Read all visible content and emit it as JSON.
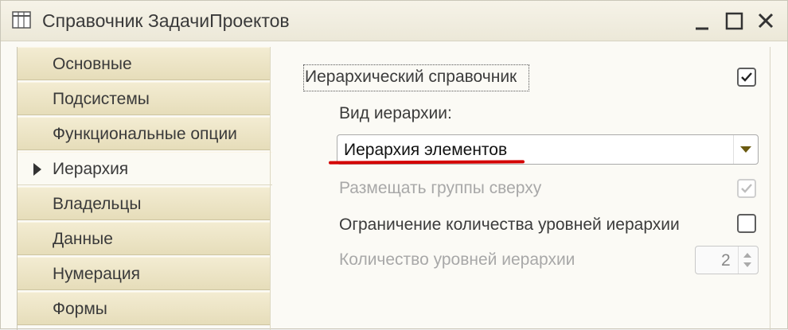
{
  "window": {
    "title": "Справочник ЗадачиПроектов",
    "icon": "table-icon",
    "controls": [
      "minimize-icon",
      "maximize-icon",
      "close-icon"
    ]
  },
  "sidebar": {
    "items": [
      {
        "label": "Основные",
        "active": false
      },
      {
        "label": "Подсистемы",
        "active": false
      },
      {
        "label": "Функциональные опции",
        "active": false
      },
      {
        "label": "Иерархия",
        "active": true
      },
      {
        "label": "Владельцы",
        "active": false
      },
      {
        "label": "Данные",
        "active": false
      },
      {
        "label": "Нумерация",
        "active": false
      },
      {
        "label": "Формы",
        "active": false
      }
    ]
  },
  "hierarchy": {
    "hierarchical_label": "Иерархический справочник",
    "hierarchical_checked": true,
    "kind_label": "Вид иерархии:",
    "kind_value": "Иерархия элементов",
    "groups_on_top_label": "Размещать группы сверху",
    "groups_on_top_checked": true,
    "groups_on_top_enabled": false,
    "limit_levels_label": "Ограничение количества уровней иерархии",
    "limit_levels_checked": false,
    "levels_count_label": "Количество уровней иерархии",
    "levels_count_value": "2",
    "levels_count_enabled": false
  },
  "colors": {
    "annotation_underline": "#d40000",
    "sidebar_tab": "#ece4c6",
    "active_tab": "#fbfaf3"
  }
}
